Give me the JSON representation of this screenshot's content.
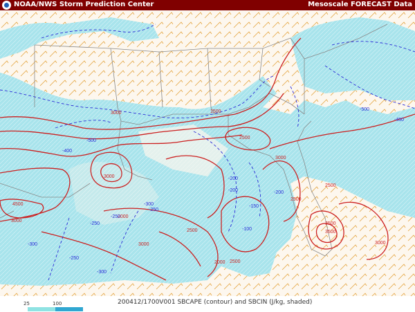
{
  "header": {
    "left_title": "NOAA/NWS Storm Prediction Center",
    "right_title": "Mesoscale FORECAST Data"
  },
  "footer": {
    "caption": "200412/1700V001 SBCAPE (contour) and SBCIN (J/kg, shaded)",
    "legend": {
      "labels": [
        "25",
        "100"
      ],
      "colors": [
        "#8fe3e3",
        "#30a7d1"
      ]
    }
  },
  "map": {
    "cape_color": "#cc1f1f",
    "cin_color": "#2b2bd6",
    "cin_shade": "#a8e4ec",
    "wind_color": "#e3a23a",
    "boundary_color": "#888888",
    "cape_labels": [
      {
        "text": "3000"
      },
      {
        "text": "2500"
      },
      {
        "text": "4500"
      },
      {
        "text": "3000"
      },
      {
        "text": "2000"
      },
      {
        "text": "3000"
      },
      {
        "text": "3500"
      },
      {
        "text": "3000"
      },
      {
        "text": "2500"
      },
      {
        "text": "2500"
      },
      {
        "text": "3000"
      },
      {
        "text": "2500"
      },
      {
        "text": "3500"
      },
      {
        "text": "3000"
      },
      {
        "text": "2500"
      },
      {
        "text": "1500"
      },
      {
        "text": "2000"
      }
    ],
    "cin_labels": [
      {
        "text": "-500"
      },
      {
        "text": "-450"
      },
      {
        "text": "-250"
      },
      {
        "text": "-300"
      },
      {
        "text": "-250"
      },
      {
        "text": "-200"
      },
      {
        "text": "-300"
      },
      {
        "text": "-250"
      },
      {
        "text": "-200"
      },
      {
        "text": "-150"
      },
      {
        "text": "-250"
      },
      {
        "text": "-300"
      },
      {
        "text": "-100"
      },
      {
        "text": "-400"
      },
      {
        "text": "-500"
      },
      {
        "text": "-200"
      }
    ]
  }
}
